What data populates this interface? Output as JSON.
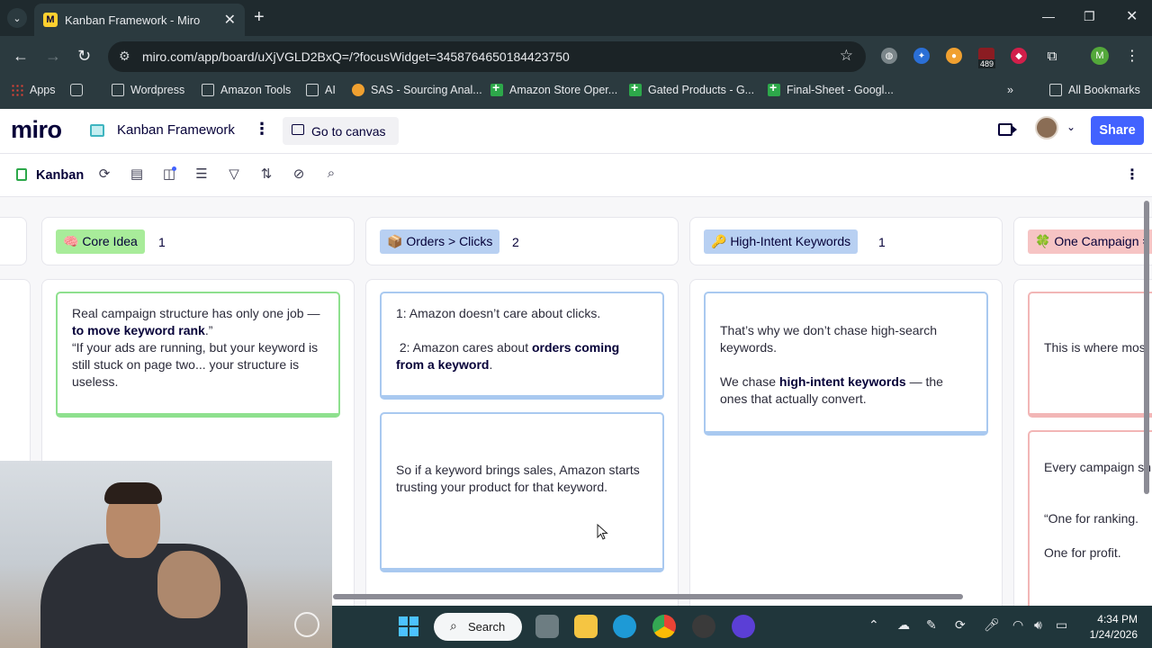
{
  "browser": {
    "tab_title": "Kanban Framework - Miro",
    "tab_favicon": "M",
    "url": "miro.com/app/board/uXjVGLD2BxQ=/?focusWidget=3458764650184423750",
    "extension_badge": "489",
    "profile_initial": "M",
    "bookmarks": [
      {
        "label": "Apps",
        "icon": "apps-grid-icon"
      },
      {
        "label": "",
        "icon": "tab-groups-icon"
      },
      {
        "label": "Wordpress",
        "icon": "folder-icon"
      },
      {
        "label": "Amazon Tools",
        "icon": "folder-icon"
      },
      {
        "label": "AI",
        "icon": "folder-icon"
      },
      {
        "label": "SAS - Sourcing Anal...",
        "icon": "sas-icon"
      },
      {
        "label": "Amazon Store Oper...",
        "icon": "sheets-icon"
      },
      {
        "label": "Gated Products - G...",
        "icon": "sheets-icon"
      },
      {
        "label": "Final-Sheet - Googl...",
        "icon": "sheets-icon"
      },
      {
        "label": "All Bookmarks",
        "icon": "folder-icon"
      }
    ]
  },
  "miro": {
    "logo": "miro",
    "board_title": "Kanban Framework",
    "go_to_canvas": "Go to canvas",
    "share": "Share"
  },
  "kanban": {
    "title": "Kanban",
    "columns": [
      {
        "label": "🧠 Core Idea",
        "count": "1",
        "chip_color": "#a8ec9a",
        "cards": [
          {
            "html": "Real campaign structure has only one job — <b>to move keyword rank</b>.”<br>“If your ads are running, but your keyword is still stuck on page two... your structure is useless."
          }
        ]
      },
      {
        "label": "📦 Orders > Clicks",
        "count": "2",
        "chip_color": "#b8d0f2",
        "cards": [
          {
            "html": "1: Amazon doesn’t care about clicks.<br><br>&nbsp;2: Amazon cares about <b>orders coming from a keyword</b>."
          },
          {
            "html": "So if a keyword brings sales, Amazon starts trusting your product for that keyword."
          }
        ]
      },
      {
        "label": "🔑 High-Intent Keywords",
        "count": "1",
        "chip_color": "#b8d0f2",
        "cards": [
          {
            "html": "That’s why we don’t chase high-search keywords.<br><br>We chase <b>high-intent keywords</b> — the ones that actually convert."
          }
        ]
      },
      {
        "label": "🍀 One Campaign =",
        "count": "",
        "chip_color": "#f6c4c4",
        "cards": [
          {
            "html": "This is where most"
          },
          {
            "html": "Every campaign sh <b>goal</b>.<br><br><br>“One for ranking.<br><br>One for profit."
          }
        ]
      }
    ]
  },
  "taskbar": {
    "search_label": "Search",
    "time": "4:34 PM",
    "date": "1/24/2026"
  }
}
